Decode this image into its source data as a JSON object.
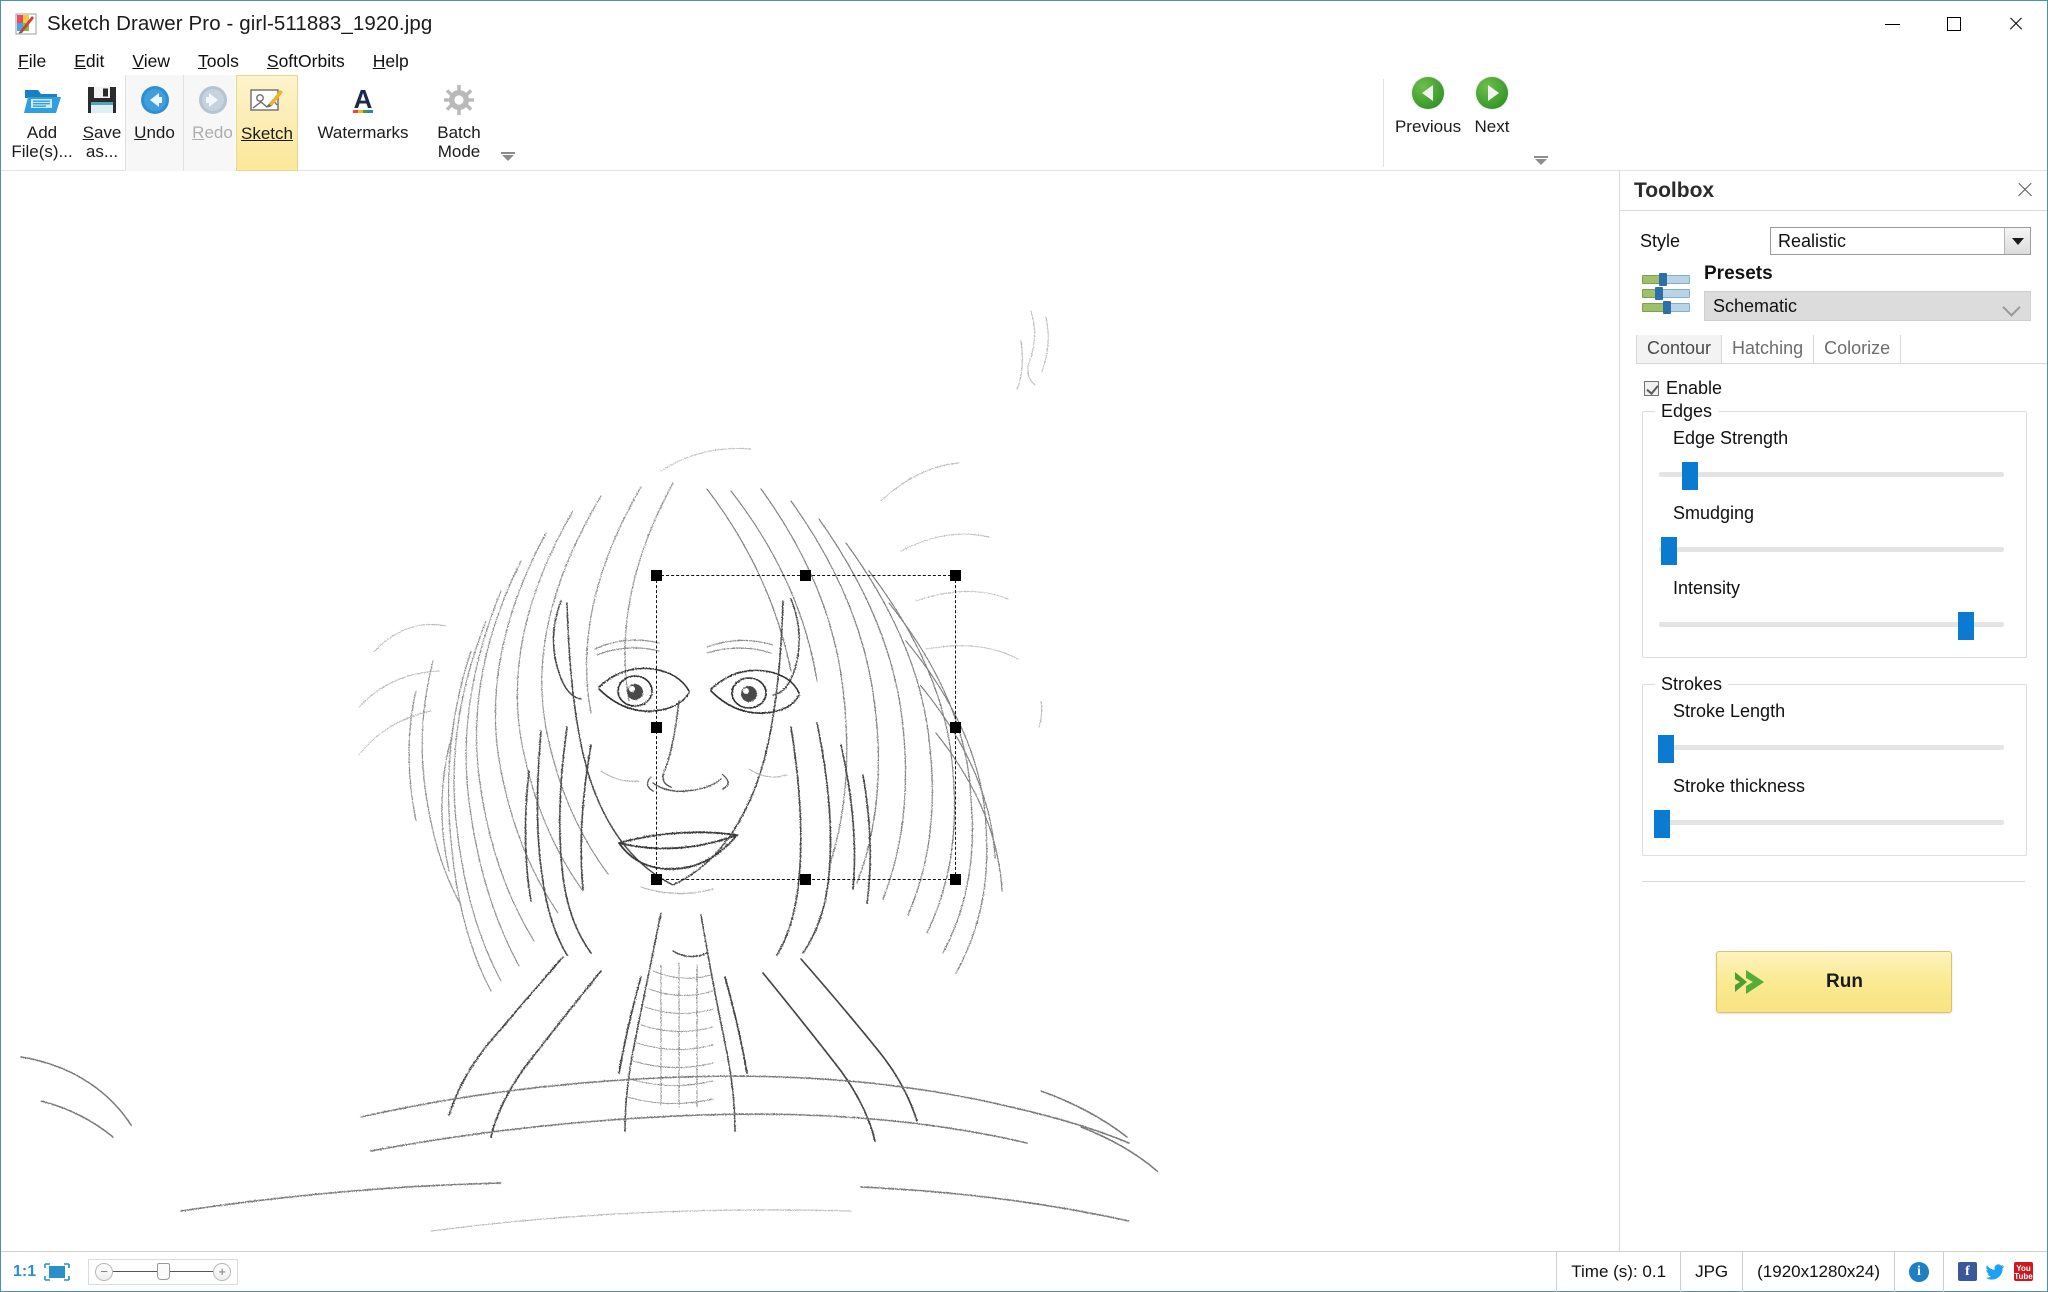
{
  "window": {
    "title": "Sketch Drawer Pro - girl-511883_1920.jpg",
    "app_icon": "app-sketch-icon",
    "minimize": "minimize-icon",
    "maximize": "maximize-icon",
    "close": "close-icon"
  },
  "menu": {
    "items": [
      {
        "label": "File",
        "accel": "F",
        "rest": "ile"
      },
      {
        "label": "Edit",
        "accel": "E",
        "rest": "dit"
      },
      {
        "label": "View",
        "accel": "V",
        "rest": "iew"
      },
      {
        "label": "Tools",
        "accel": "T",
        "rest": "ools"
      },
      {
        "label": "SoftOrbits",
        "accel": "S",
        "rest": "oftOrbits"
      },
      {
        "label": "Help",
        "accel": "H",
        "rest": "elp"
      }
    ]
  },
  "toolbar": {
    "add_files": "Add",
    "add_files_2": "File(s)...",
    "save_as": "Save",
    "save_as_2": "as...",
    "undo": "Undo",
    "redo": "Redo",
    "sketch": "Sketch",
    "watermarks": "Watermarks",
    "batch_mode": "Batch",
    "batch_mode_2": "Mode",
    "previous": "Previous",
    "next": "Next"
  },
  "toolbox": {
    "title": "Toolbox",
    "style_label": "Style",
    "style_value": "Realistic",
    "presets_label": "Presets",
    "presets_value": "Schematic",
    "tabs": [
      {
        "label": "Contour",
        "active": true
      },
      {
        "label": "Hatching",
        "active": false
      },
      {
        "label": "Colorize",
        "active": false
      }
    ],
    "enable_label": "Enable",
    "enable_checked": true,
    "edges_group": "Edges",
    "strokes_group": "Strokes",
    "sliders": [
      {
        "label": "Edge Strength",
        "percent": 9
      },
      {
        "label": "Smudging",
        "percent": 3
      },
      {
        "label": "Intensity",
        "percent": 89
      },
      {
        "label": "Stroke Length",
        "percent": 2
      },
      {
        "label": "Stroke thickness",
        "percent": 1
      }
    ],
    "run_label": "Run",
    "accent_blue": "#0b7ad1",
    "run_yellow": "#fbea92"
  },
  "statusbar": {
    "zoom_ratio": "1:1",
    "time": "Time (s): 0.1",
    "format": "JPG",
    "dimensions": "(1920x1280x24)",
    "info_icon": "info-icon",
    "facebook": "f",
    "youtube": "You",
    "youtube2": "Tube"
  }
}
